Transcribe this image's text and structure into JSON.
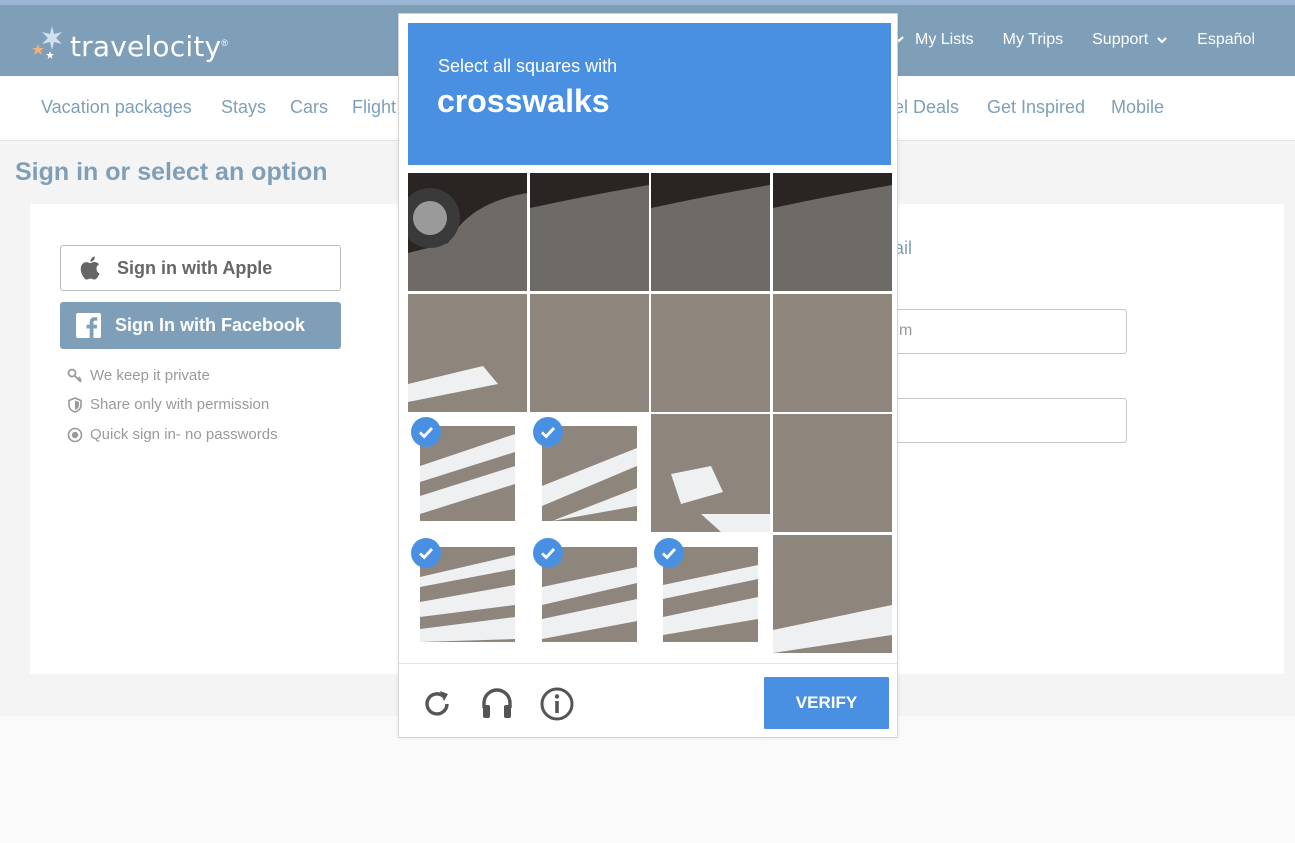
{
  "header": {
    "logo_text": "travelocity",
    "logo_mark": "®",
    "top_links": [
      {
        "label": "My Lists"
      },
      {
        "label": "My Trips"
      },
      {
        "label": "Support"
      },
      {
        "label": "Español"
      }
    ]
  },
  "subnav": {
    "items": [
      {
        "label": "Vacation packages"
      },
      {
        "label": "Stays"
      },
      {
        "label": "Cars"
      },
      {
        "label": "Flight"
      },
      {
        "label": "el Deals"
      },
      {
        "label": "Get Inspired"
      },
      {
        "label": "Mobile"
      }
    ]
  },
  "page": {
    "title": "Sign in or select an option",
    "apple_button": "Sign in with Apple",
    "facebook_button": "Sign In with Facebook",
    "perks": [
      {
        "icon": "key-icon",
        "label": "We keep it private"
      },
      {
        "icon": "shield-icon",
        "label": "Share only with permission"
      },
      {
        "icon": "circle-icon",
        "label": "Quick sign in- no passwords"
      }
    ],
    "right_heading_fragment": "ail",
    "email_field_fragment": "m"
  },
  "captcha": {
    "instruction": "Select all squares with",
    "target": "crosswalks",
    "verify_label": "VERIFY",
    "tiles_selected": [
      false,
      false,
      false,
      false,
      false,
      false,
      false,
      false,
      true,
      true,
      false,
      false,
      true,
      true,
      true,
      false
    ],
    "icons": [
      "reload-icon",
      "audio-icon",
      "info-icon"
    ]
  },
  "colors": {
    "brand": "#7f9fb8",
    "captcha_blue": "#4a90e2"
  }
}
